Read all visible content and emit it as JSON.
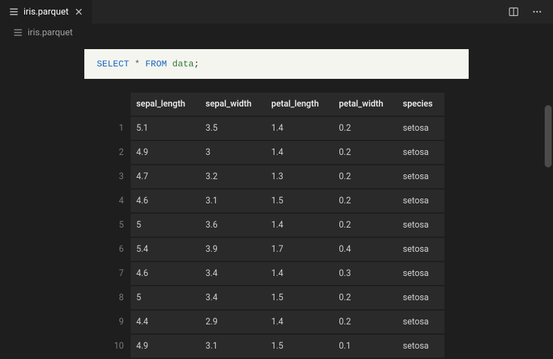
{
  "tab": {
    "label": "iris.parquet"
  },
  "open_editor": {
    "label": "iris.parquet"
  },
  "query": {
    "kw_select": "SELECT",
    "star": "*",
    "kw_from": "FROM",
    "table": "data",
    "semi": ";"
  },
  "columns": [
    "sepal_length",
    "sepal_width",
    "petal_length",
    "petal_width",
    "species"
  ],
  "row_nums": [
    "1",
    "2",
    "3",
    "4",
    "5",
    "6",
    "7",
    "8",
    "9",
    "10"
  ],
  "rows": [
    [
      "5.1",
      "3.5",
      "1.4",
      "0.2",
      "setosa"
    ],
    [
      "4.9",
      "3",
      "1.4",
      "0.2",
      "setosa"
    ],
    [
      "4.7",
      "3.2",
      "1.3",
      "0.2",
      "setosa"
    ],
    [
      "4.6",
      "3.1",
      "1.5",
      "0.2",
      "setosa"
    ],
    [
      "5",
      "3.6",
      "1.4",
      "0.2",
      "setosa"
    ],
    [
      "5.4",
      "3.9",
      "1.7",
      "0.4",
      "setosa"
    ],
    [
      "4.6",
      "3.4",
      "1.4",
      "0.3",
      "setosa"
    ],
    [
      "5",
      "3.4",
      "1.5",
      "0.2",
      "setosa"
    ],
    [
      "4.4",
      "2.9",
      "1.4",
      "0.2",
      "setosa"
    ],
    [
      "4.9",
      "3.1",
      "1.5",
      "0.1",
      "setosa"
    ]
  ]
}
